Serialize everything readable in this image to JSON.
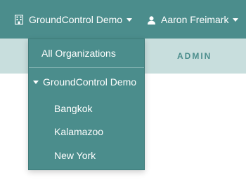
{
  "header": {
    "org_switcher_label": "GroundControl Demo",
    "user_label": "Aaron Freimark"
  },
  "tabs": {
    "admin_label": "ADMIN"
  },
  "org_dropdown": {
    "all_label": "All Organizations",
    "current_org_label": "GroundControl Demo",
    "children": [
      "Bangkok",
      "Kalamazoo",
      "New York"
    ]
  },
  "colors": {
    "primary": "#4b8d8c",
    "secondary_bar": "#c8dedd",
    "text_light": "#ffffff"
  },
  "icons": {
    "org_switcher": "building-icon",
    "user": "user-icon",
    "dropdown": "caret-down-icon"
  }
}
